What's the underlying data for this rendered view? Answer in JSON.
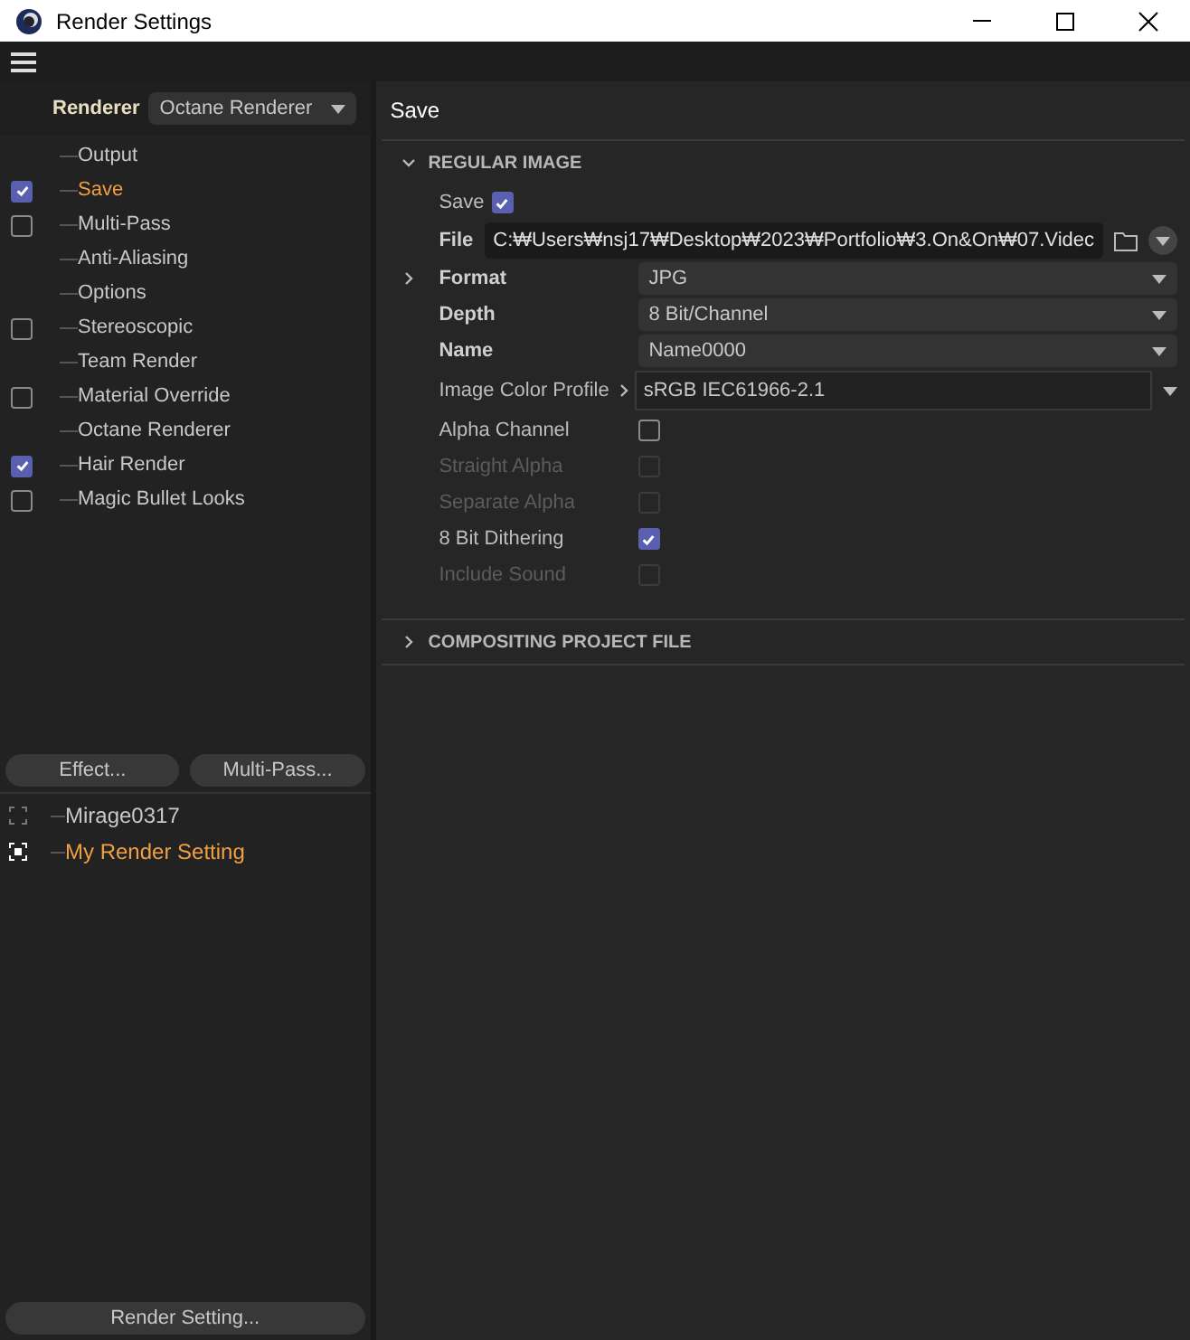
{
  "window": {
    "title": "Render Settings"
  },
  "renderer": {
    "label": "Renderer",
    "value": "Octane Renderer"
  },
  "sidebar": {
    "items": [
      {
        "label": "Output",
        "kind": "plain",
        "selected": false
      },
      {
        "label": "Save",
        "kind": "checkbox",
        "checked": true,
        "selected": true
      },
      {
        "label": "Multi-Pass",
        "kind": "checkbox",
        "checked": false,
        "selected": false
      },
      {
        "label": "Anti-Aliasing",
        "kind": "plain",
        "selected": false
      },
      {
        "label": "Options",
        "kind": "plain",
        "selected": false
      },
      {
        "label": "Stereoscopic",
        "kind": "checkbox",
        "checked": false,
        "selected": false
      },
      {
        "label": "Team Render",
        "kind": "plain",
        "selected": false
      },
      {
        "label": "Material Override",
        "kind": "checkbox",
        "checked": false,
        "selected": false
      },
      {
        "label": "Octane Renderer",
        "kind": "plain",
        "selected": false
      },
      {
        "label": "Hair Render",
        "kind": "checkbox",
        "checked": true,
        "selected": false
      },
      {
        "label": "Magic Bullet Looks",
        "kind": "checkbox",
        "checked": false,
        "selected": false
      }
    ]
  },
  "sidebar_buttons": [
    "Effect...",
    "Multi-Pass..."
  ],
  "presets": [
    {
      "label": "Mirage0317",
      "selected": false
    },
    {
      "label": "My Render Setting",
      "selected": true
    }
  ],
  "footer_button": "Render Setting...",
  "panel": {
    "title": "Save",
    "sections": [
      {
        "title": "REGULAR IMAGE",
        "expanded": true,
        "rows": [
          {
            "kind": "inline_checkbox",
            "label": "Save",
            "checked": true,
            "disabled": false
          },
          {
            "kind": "file",
            "label": "File",
            "value": "C:₩Users₩nsj17₩Desktop₩2023₩Portfolio₩3.On&On₩07.Videc"
          },
          {
            "kind": "dropdown",
            "label": "Format",
            "value": "JPG",
            "expandable": true
          },
          {
            "kind": "dropdown",
            "label": "Depth",
            "value": "8 Bit/Channel",
            "expandable": false
          },
          {
            "kind": "dropdown",
            "label": "Name",
            "value": "Name0000",
            "expandable": false
          },
          {
            "kind": "profile",
            "label": "Image Color Profile",
            "value": "sRGB IEC61966-2.1"
          },
          {
            "kind": "checkbox",
            "label": "Alpha Channel",
            "checked": false,
            "disabled": false
          },
          {
            "kind": "checkbox",
            "label": "Straight Alpha",
            "checked": false,
            "disabled": true
          },
          {
            "kind": "checkbox",
            "label": "Separate Alpha",
            "checked": false,
            "disabled": true
          },
          {
            "kind": "checkbox",
            "label": "8 Bit Dithering",
            "checked": true,
            "disabled": false
          },
          {
            "kind": "checkbox",
            "label": "Include Sound",
            "checked": false,
            "disabled": true
          }
        ]
      },
      {
        "title": "COMPOSITING PROJECT FILE",
        "expanded": false
      }
    ]
  }
}
